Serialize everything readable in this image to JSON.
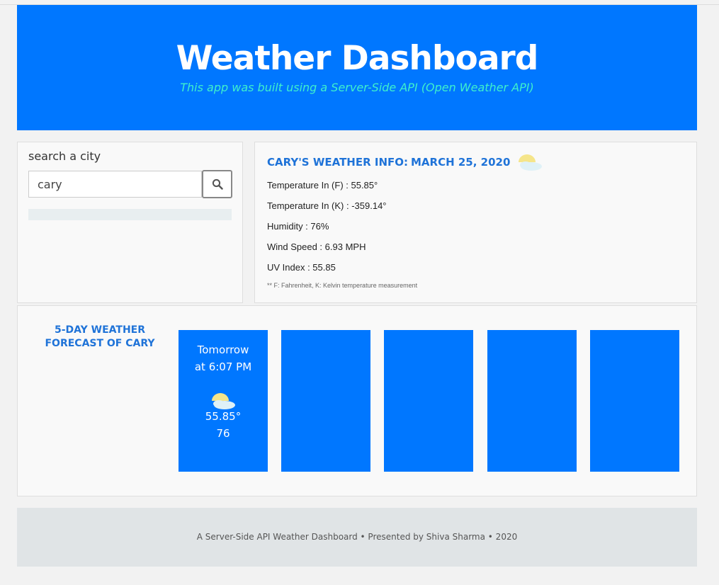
{
  "header": {
    "title": "Weather Dashboard",
    "subtitle": "This app was built using a Server-Side API (Open Weather API)"
  },
  "search": {
    "label": "search a city",
    "value": "cary",
    "button_icon": "search-icon"
  },
  "current": {
    "heading": "CARY'S WEATHER INFO:",
    "date": "MARCH 25, 2020",
    "icon": "partly-cloudy-icon",
    "temp_f": "Temperature In (F) : 55.85°",
    "temp_k": "Temperature In (K) : -359.14°",
    "humidity": "Humidity : 76%",
    "wind": "Wind Speed : 6.93 MPH",
    "uv": "UV Index : 55.85",
    "note": "** F: Fahrenheit, K: Kelvin temperature measurement"
  },
  "forecast": {
    "title": "5-DAY WEATHER FORECAST OF CARY",
    "cards": [
      {
        "time_line1": "Tomorrow",
        "time_line2": "at 6:07 PM",
        "icon": "partly-cloudy-icon",
        "temp": "55.85°",
        "humidity": "76"
      },
      {
        "time_line1": "",
        "time_line2": "",
        "icon": "",
        "temp": "",
        "humidity": ""
      },
      {
        "time_line1": "",
        "time_line2": "",
        "icon": "",
        "temp": "",
        "humidity": ""
      },
      {
        "time_line1": "",
        "time_line2": "",
        "icon": "",
        "temp": "",
        "humidity": ""
      },
      {
        "time_line1": "",
        "time_line2": "",
        "icon": "",
        "temp": "",
        "humidity": ""
      }
    ]
  },
  "footer": {
    "text": "A Server-Side API Weather Dashboard • Presented by Shiva Sharma • 2020"
  },
  "colors": {
    "brand_blue": "#0077ff",
    "heading_blue": "#1f73d8",
    "subtitle_teal": "#3ef0cc"
  }
}
